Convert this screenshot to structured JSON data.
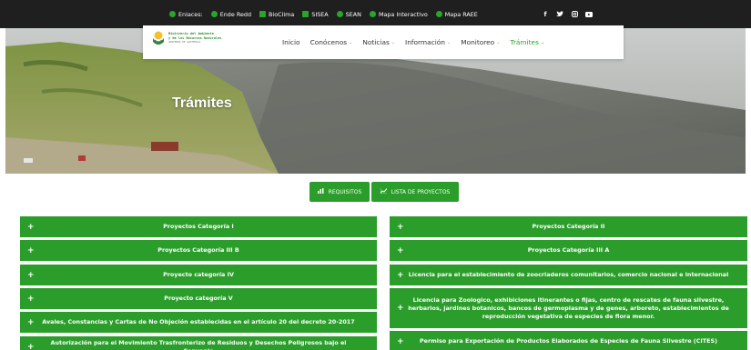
{
  "topbar": {
    "enlaces_label": "Enlaces:",
    "links": [
      "Ende Redd",
      "BioClima",
      "SISEA",
      "SEAN",
      "Mapa Interactivo",
      "Mapa RAEE"
    ],
    "social_icons": [
      "facebook-icon",
      "twitter-icon",
      "instagram-icon",
      "youtube-icon"
    ]
  },
  "logo": {
    "line1": "Ministerio del Ambiente",
    "line2": "y de los Recursos Naturales",
    "line3": "GOBIERNO DE GUATEMALA"
  },
  "nav": {
    "items": [
      {
        "label": "Inicio",
        "dropdown": false,
        "active": false
      },
      {
        "label": "Conócenos",
        "dropdown": true,
        "active": false
      },
      {
        "label": "Noticias",
        "dropdown": true,
        "active": false
      },
      {
        "label": "Información",
        "dropdown": true,
        "active": false
      },
      {
        "label": "Monitoreo",
        "dropdown": true,
        "active": false
      },
      {
        "label": "Trámites",
        "dropdown": true,
        "active": true
      }
    ]
  },
  "hero": {
    "title": "Trámites"
  },
  "buttons": {
    "requisitos": "REQUISITOS",
    "proyectos": "LISTA DE PROYECTOS"
  },
  "accordion": {
    "left": [
      "Proyectos Categoría I",
      "Proyectos Categoría III B",
      "Proyecto categoría IV",
      "Proyecto categoría V",
      "Avales, Constancias y Cartas de No Objeción establecidas en el artículo 20 del decreto 20-2017",
      "Autorización para el Movimiento Trasfronterizo de Residuos y Desechos Peligrosos bajo el Convenio"
    ],
    "right": [
      "Proyectos Categoría II",
      "Proyectos Categoría III A",
      "Licencia para el establecimiento de zoocriaderos comunitarios, comercio nacional e internacional",
      "Licencia para Zoologico, exhibiciones itinerantes o fijas, centro de rescates de fauna silvestre, herbarios, jardines botanicos, bancos de germoplasma y de genes, arboreto, establecimientos de reproducción vegetativa de especies de flora menor.",
      "Permiso para Exportación de Productos Elaborados de Especies de Fauna Silvestre (CITES)"
    ],
    "plus": "+"
  },
  "colors": {
    "green": "#2a9d2a",
    "topbar": "#1f1f1f"
  }
}
